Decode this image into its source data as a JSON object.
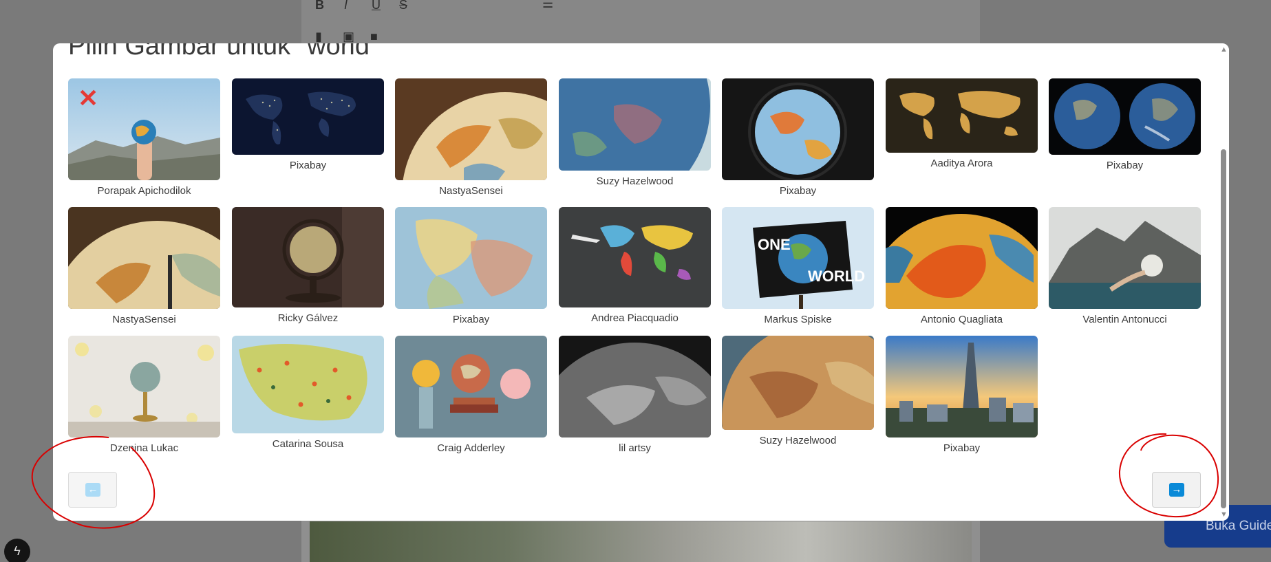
{
  "modal": {
    "title": "Pilih Gambar untuk \"world\""
  },
  "images": [
    {
      "caption": "Porapak Apichodilok",
      "selected": true
    },
    {
      "caption": "Pixabay"
    },
    {
      "caption": "NastyaSensei"
    },
    {
      "caption": "Suzy Hazelwood"
    },
    {
      "caption": "Pixabay"
    },
    {
      "caption": "Aaditya Arora"
    },
    {
      "caption": "Pixabay"
    },
    {
      "caption": "NastyaSensei"
    },
    {
      "caption": "Ricky Gálvez"
    },
    {
      "caption": "Pixabay"
    },
    {
      "caption": "Andrea Piacquadio"
    },
    {
      "caption": "Markus Spiske"
    },
    {
      "caption": "Antonio Quagliata"
    },
    {
      "caption": "Valentin Antonucci"
    },
    {
      "caption": "Dzenina Lukac"
    },
    {
      "caption": "Catarina Sousa"
    },
    {
      "caption": "Craig Adderley"
    },
    {
      "caption": "lil artsy"
    },
    {
      "caption": "Suzy Hazelwood"
    },
    {
      "caption": "Pixabay"
    }
  ],
  "image_art": {
    "one_world_text": "ONE WORLD"
  },
  "pagination": {
    "prev_icon": "arrow-left-icon",
    "next_icon": "arrow-right-icon",
    "prev_disabled": true
  },
  "background": {
    "guide_button_label": "Buka Guide"
  },
  "colors": {
    "accent": "#0a8ad8",
    "annotation": "#d90000",
    "remove": "#e53935"
  }
}
